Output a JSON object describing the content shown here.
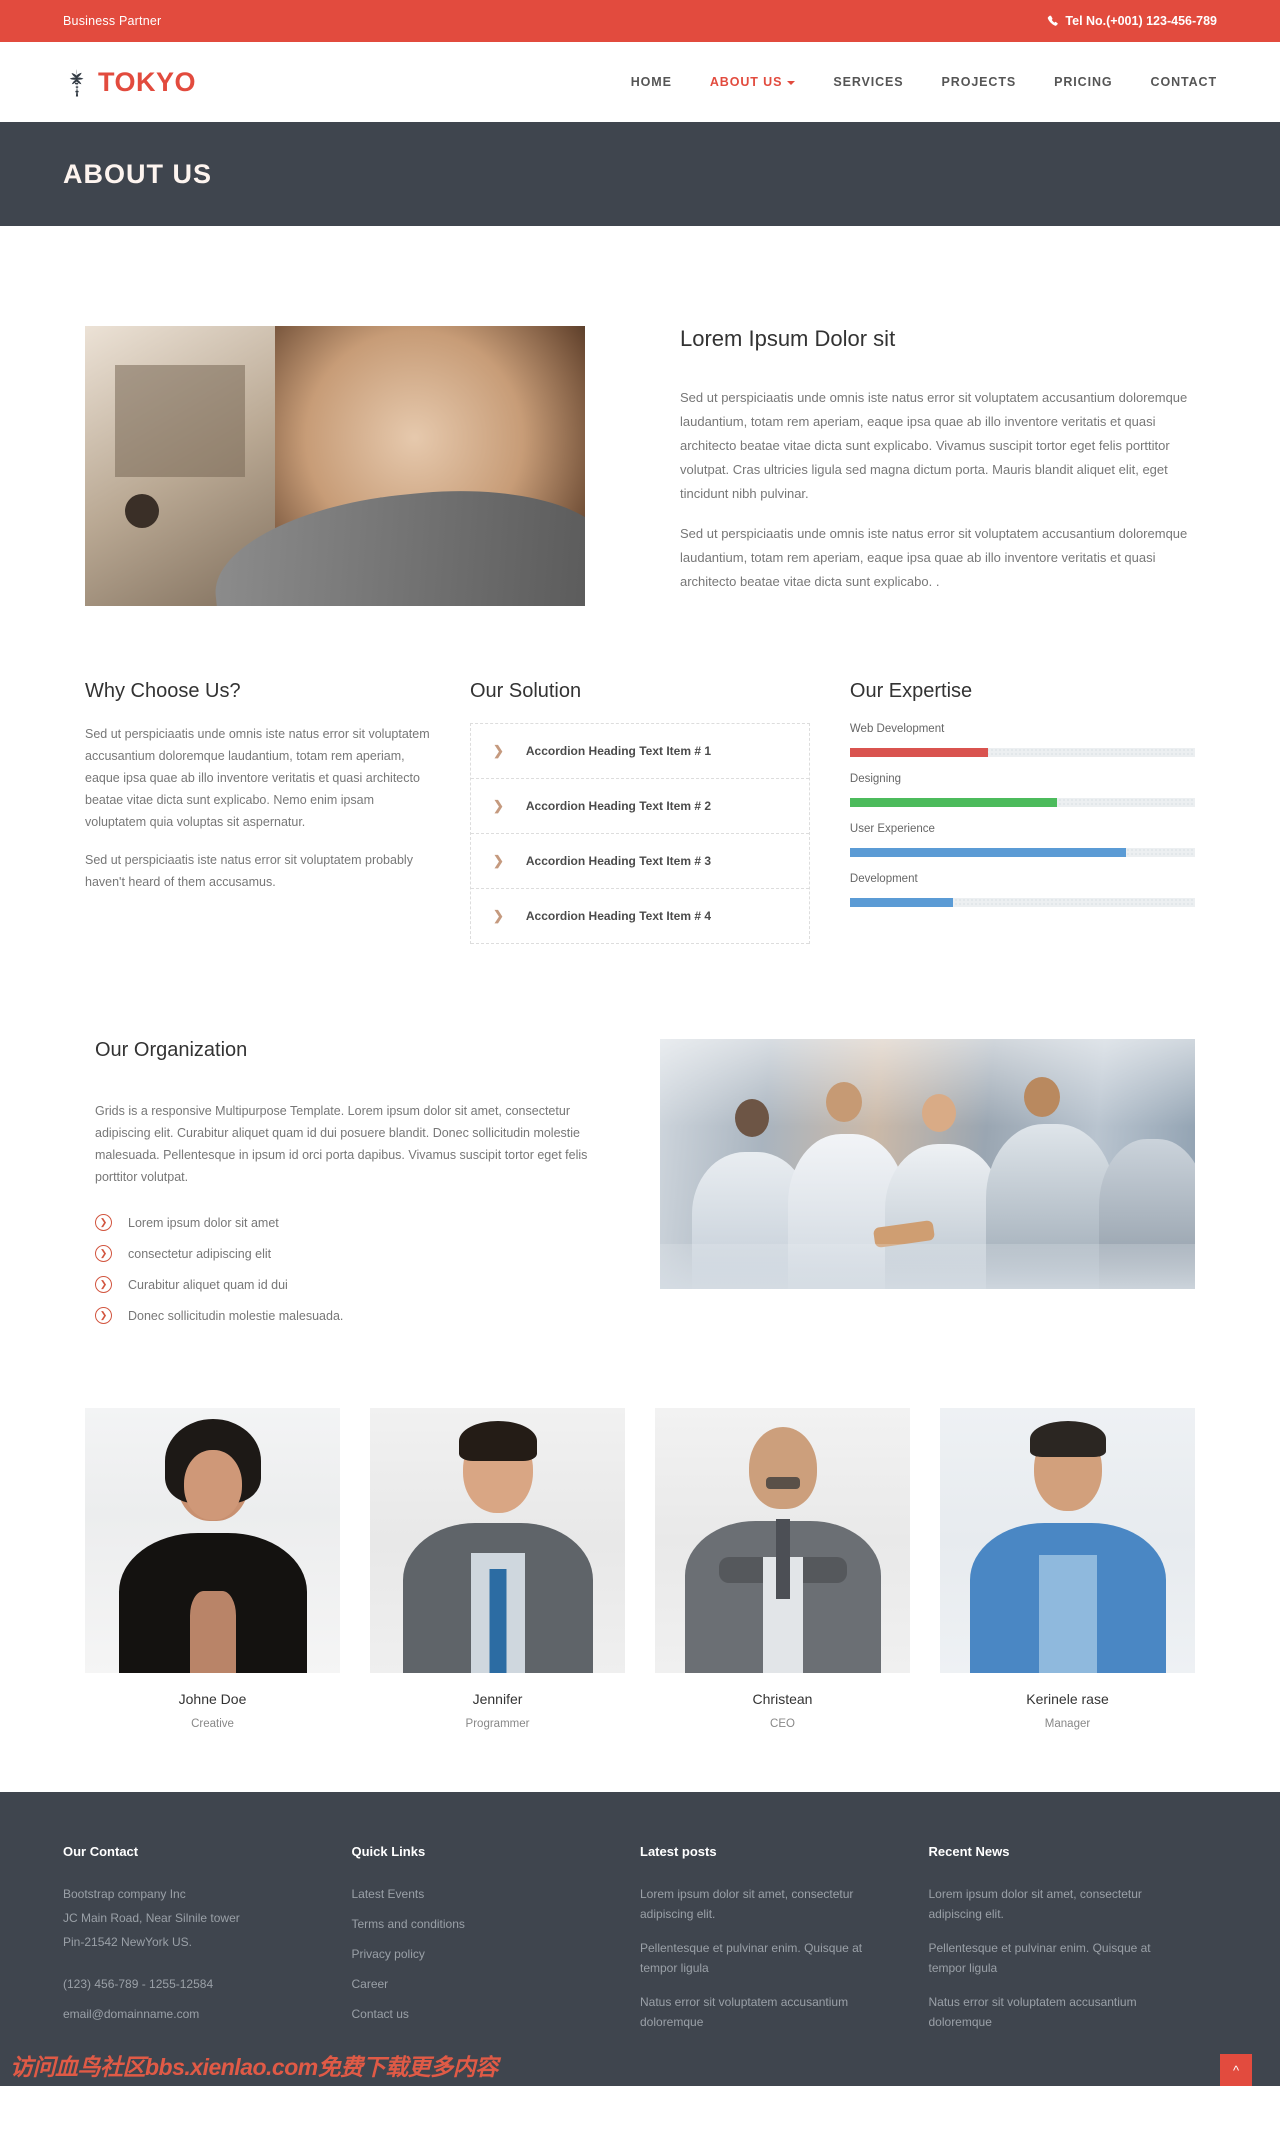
{
  "topbar": {
    "tagline": "Business Partner",
    "phone_icon": "phone-icon",
    "phone": "Tel No.(+001) 123-456-789"
  },
  "header": {
    "logo_icon": "tree-logo-icon",
    "brand": "TOKYO",
    "nav": [
      {
        "label": "HOME",
        "active": false,
        "caret": false
      },
      {
        "label": "ABOUT US",
        "active": true,
        "caret": true
      },
      {
        "label": "SERVICES",
        "active": false,
        "caret": false
      },
      {
        "label": "PROJECTS",
        "active": false,
        "caret": false
      },
      {
        "label": "PRICING",
        "active": false,
        "caret": false
      },
      {
        "label": "CONTACT",
        "active": false,
        "caret": false
      }
    ]
  },
  "banner": {
    "title": "ABOUT US"
  },
  "intro": {
    "image_alt": "bearded-man-portrait",
    "heading": "Lorem Ipsum Dolor sit",
    "paragraph1": "Sed ut perspiciaatis unde omnis iste natus error sit voluptatem accusantium doloremque laudantium, totam rem aperiam, eaque ipsa quae ab illo inventore veritatis et quasi architecto beatae vitae dicta sunt explicabo. Vivamus suscipit tortor eget felis porttitor volutpat. Cras ultricies ligula sed magna dictum porta. Mauris blandit aliquet elit, eget tincidunt nibh pulvinar.",
    "paragraph2": "Sed ut perspiciaatis unde omnis iste natus error sit voluptatem accusantium doloremque laudantium, totam rem aperiam, eaque ipsa quae ab illo inventore veritatis et quasi architecto beatae vitae dicta sunt explicabo. ."
  },
  "why": {
    "heading": "Why Choose Us?",
    "paragraph1": "Sed ut perspiciaatis unde omnis iste natus error sit voluptatem accusantium doloremque laudantium, totam rem aperiam, eaque ipsa quae ab illo inventore veritatis et quasi architecto beatae vitae dicta sunt explicabo. Nemo enim ipsam voluptatem quia voluptas sit aspernatur.",
    "paragraph2": "Sed ut perspiciaatis iste natus error sit voluptatem probably haven't heard of them accusamus."
  },
  "solution": {
    "heading": "Our Solution",
    "chevron_icon": "chevron-right-icon",
    "items": [
      {
        "label": "Accordion Heading Text Item # 1"
      },
      {
        "label": "Accordion Heading Text Item # 2"
      },
      {
        "label": "Accordion Heading Text Item # 3"
      },
      {
        "label": "Accordion Heading Text Item # 4"
      }
    ]
  },
  "expertise": {
    "heading": "Our Expertise",
    "skills": [
      {
        "label": "Web Development",
        "percent": 40,
        "color": "#d9534f",
        "striped": false
      },
      {
        "label": "Designing",
        "percent": 60,
        "color": "#4cbb5c",
        "striped": false
      },
      {
        "label": "User Experience",
        "percent": 80,
        "color": "#5b9bd5",
        "striped": true
      },
      {
        "label": "Development",
        "percent": 30,
        "color": "#5b9bd5",
        "striped": true
      }
    ]
  },
  "organization": {
    "heading": "Our Organization",
    "paragraph": "Grids is a responsive Multipurpose Template. Lorem ipsum dolor sit amet, consectetur adipiscing elit. Curabitur aliquet quam id dui posuere blandit. Donec sollicitudin molestie malesuada. Pellentesque in ipsum id orci porta dapibus. Vivamus suscipit tortor eget felis porttitor volutpat.",
    "bullet_icon": "circle-chevron-right-icon",
    "bullets": [
      "Lorem ipsum dolor sit amet",
      "consectetur adipiscing elit",
      "Curabitur aliquet quam id dui",
      "Donec sollicitudin molestie malesuada."
    ],
    "image_alt": "business-team-handshake-meeting"
  },
  "team": [
    {
      "name": "Johne Doe",
      "role": "Creative",
      "photo_alt": "woman-in-black-blazer"
    },
    {
      "name": "Jennifer",
      "role": "Programmer",
      "photo_alt": "young-man-in-grey-suit"
    },
    {
      "name": "Christean",
      "role": "CEO",
      "photo_alt": "bald-man-arms-crossed"
    },
    {
      "name": "Kerinele rase",
      "role": "Manager",
      "photo_alt": "man-in-blue-shirt"
    }
  ],
  "footer": {
    "columns": [
      {
        "title": "Our Contact",
        "lines": [
          "Bootstrap company Inc",
          "JC Main Road, Near Silnile tower",
          "Pin-21542 NewYork US."
        ],
        "contact": [
          "(123) 456-789 - 1255-12584",
          "email@domainname.com"
        ]
      },
      {
        "title": "Quick Links",
        "links": [
          "Latest Events",
          "Terms and conditions",
          "Privacy policy",
          "Career",
          "Contact us"
        ]
      },
      {
        "title": "Latest posts",
        "posts": [
          "Lorem ipsum dolor sit amet, consectetur adipiscing elit.",
          "Pellentesque et pulvinar enim. Quisque at tempor ligula",
          "Natus error sit voluptatem accusantium doloremque"
        ]
      },
      {
        "title": "Recent News",
        "posts": [
          "Lorem ipsum dolor sit amet, consectetur adipiscing elit.",
          "Pellentesque et pulvinar enim. Quisque at tempor ligula",
          "Natus error sit voluptatem accusantium doloremque"
        ]
      }
    ]
  },
  "watermark": "访问血鸟社区bbs.xienlao.com免费下载更多内容",
  "back_to_top": {
    "icon": "chevron-up-icon",
    "label": "^"
  },
  "colors": {
    "accent": "#e24b3e",
    "dark": "#3f454e",
    "body_text": "#777777"
  }
}
